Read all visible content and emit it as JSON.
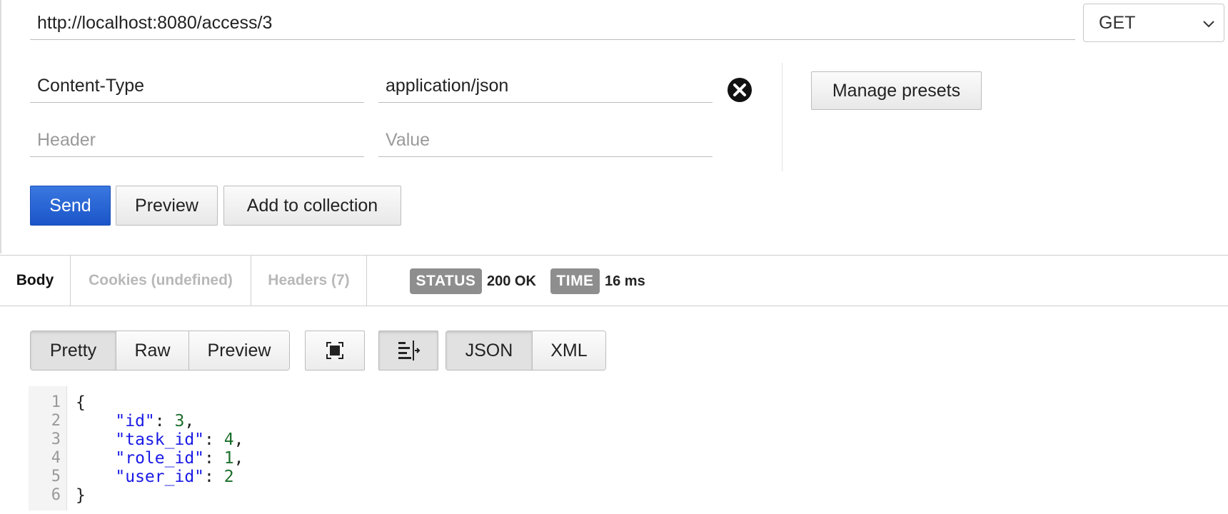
{
  "request": {
    "url": "http://localhost:8080/access/3",
    "method": "GET",
    "headers": [
      {
        "key": "Content-Type",
        "value": "application/json"
      }
    ],
    "header_placeholder": "Header",
    "value_placeholder": "Value",
    "manage_presets_label": "Manage presets"
  },
  "actions": {
    "send_label": "Send",
    "preview_label": "Preview",
    "add_to_collection_label": "Add to collection"
  },
  "response": {
    "tabs": [
      "Body",
      "Cookies (undefined)",
      "Headers (7)"
    ],
    "status_label": "STATUS",
    "status_value": "200 OK",
    "time_label": "TIME",
    "time_value": "16 ms",
    "format_tabs": [
      "Pretty",
      "Raw",
      "Preview"
    ],
    "type_tabs": [
      "JSON",
      "XML"
    ],
    "icons": [
      "fullscreen-icon",
      "wrap-lines-icon"
    ],
    "line_numbers": [
      "1",
      "2",
      "3",
      "4",
      "5",
      "6"
    ],
    "body": {
      "open": "{",
      "close": "}",
      "fields": [
        {
          "key": "\"id\"",
          "value": "3",
          "sep": ","
        },
        {
          "key": "\"task_id\"",
          "value": "4",
          "sep": ","
        },
        {
          "key": "\"role_id\"",
          "value": "1",
          "sep": ","
        },
        {
          "key": "\"user_id\"",
          "value": "2",
          "sep": ""
        }
      ]
    }
  },
  "colors": {
    "send_button": "#1b55c8",
    "status_badge": "#8e8e8e",
    "json_key": "#1a1ae6",
    "json_number": "#1b6e2a"
  }
}
